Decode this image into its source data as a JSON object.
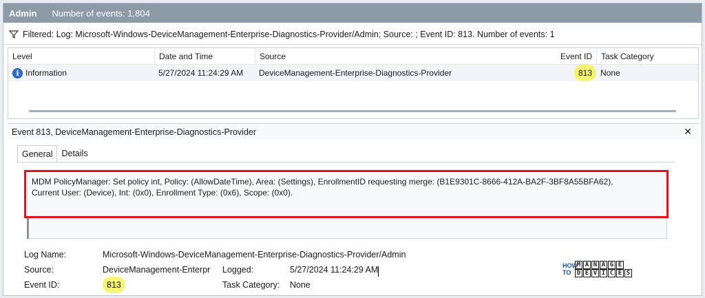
{
  "header": {
    "title": "Admin",
    "count": "Number of events: 1,804"
  },
  "filter": {
    "text": "Filtered: Log: Microsoft-Windows-DeviceManagement-Enterprise-Diagnostics-Provider/Admin; Source: ; Event ID: 813. Number of events: 1"
  },
  "grid": {
    "columns": {
      "level": "Level",
      "date": "Date and Time",
      "source": "Source",
      "event": "Event ID",
      "task": "Task Category"
    },
    "row": {
      "level": "Information",
      "date": "5/27/2024 11:24:29 AM",
      "source": "DeviceManagement-Enterprise-Diagnostics-Provider",
      "event": "813",
      "task": "None"
    }
  },
  "detail": {
    "title": "Event 813, DeviceManagement-Enterprise-Diagnostics-Provider",
    "tabs": {
      "general": "General",
      "details": "Details"
    },
    "message_line1": "MDM PolicyManager: Set policy int, Policy: (AllowDateTime), Area: (Settings), EnrollmentID requesting merge: (B1E9301C-8666-412A-BA2F-3BF8A55BFA62),",
    "message_line2": "Current User: (Device), Int: (0x0), Enrollment Type: (0x6), Scope: (0x0).",
    "props": {
      "log_name_label": "Log Name:",
      "log_name": "Microsoft-Windows-DeviceManagement-Enterprise-Diagnostics-Provider/Admin",
      "source_label": "Source:",
      "source": "DeviceManagement-Enterpr",
      "logged_label": "Logged:",
      "logged": "5/27/2024 11:24:29 AM",
      "event_id_label": "Event ID:",
      "event_id": "813",
      "task_label": "Task Category:",
      "task": "None"
    }
  },
  "logo": {
    "how": "HOW",
    "to": "TO",
    "manage": "MANAGE",
    "devices": "DEVICES"
  },
  "colors": {
    "header_bg": "#8d9aa8",
    "highlight": "#f4f35a",
    "annotation": "#e0141c",
    "info_icon": "#2a6fd1"
  }
}
